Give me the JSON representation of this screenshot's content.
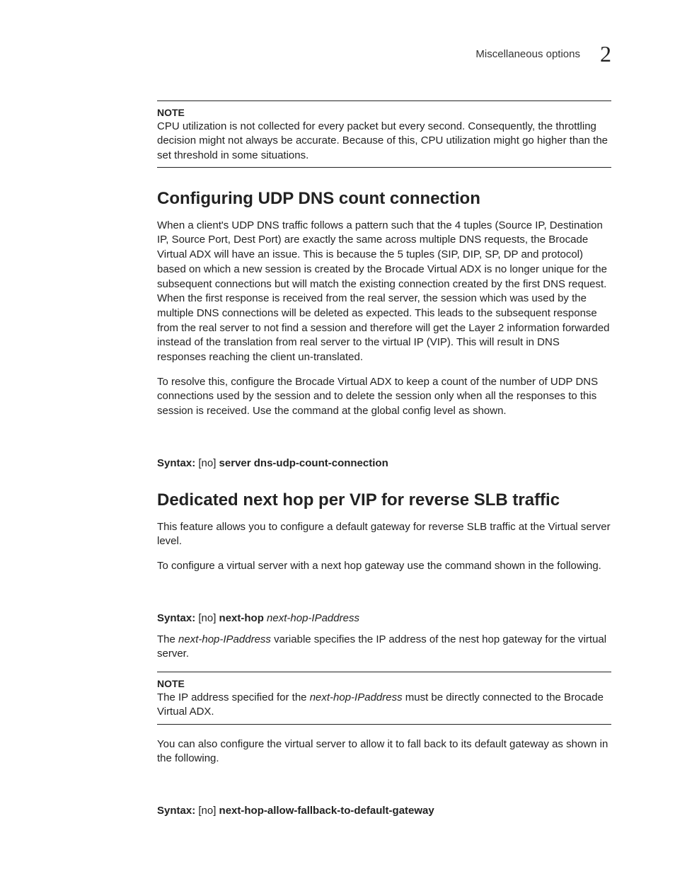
{
  "header": {
    "running_title": "Miscellaneous options",
    "chapter_number": "2"
  },
  "note1": {
    "label": "NOTE",
    "body": "CPU utilization is not collected for every packet but every second. Consequently, the throttling decision might not always be accurate. Because of this, CPU utilization might go higher than the set threshold in some situations."
  },
  "section1": {
    "heading": "Configuring UDP DNS count connection",
    "para1": "When a client's UDP DNS traffic follows a pattern such that the 4 tuples (Source IP, Destination IP, Source Port, Dest Port) are exactly the same across multiple DNS requests, the Brocade Virtual ADX will have an issue. This is because the 5 tuples (SIP, DIP, SP, DP and protocol) based on which a new session is created by the Brocade Virtual ADX is no longer unique for the subsequent connections but will match the existing connection created by the first DNS request. When the first response is received from the real server, the session which was used by the multiple DNS connections will be deleted as expected. This leads to the subsequent response from the real server to not find a session and therefore will get the Layer 2 information forwarded instead of the translation from real server to the virtual IP (VIP). This will result in DNS responses reaching the client un-translated.",
    "para2": "To resolve this, configure the Brocade Virtual ADX to keep a count of the number of UDP DNS connections used by the session and to delete the session only when all the responses to this session is received. Use the command at the global config level as shown.",
    "syntax_label": "Syntax:  ",
    "syntax_no": "[no] ",
    "syntax_cmd": "server dns-udp-count-connection"
  },
  "section2": {
    "heading": "Dedicated next hop per VIP for reverse SLB traffic",
    "para1": "This feature allows you to configure a default gateway for reverse SLB traffic at the Virtual server level.",
    "para2": "To configure a virtual server with a next hop gateway use the command shown in the following.",
    "syntax1_label": "Syntax:  ",
    "syntax1_no": "[no] ",
    "syntax1_cmd": "next-hop ",
    "syntax1_arg": "next-hop-IPaddress",
    "para3_pre": "The ",
    "para3_var": "next-hop-IPaddress",
    "para3_post": " variable specifies the IP address of the nest hop gateway for the virtual server.",
    "note2_label": "NOTE",
    "note2_pre": "The IP address specified for the ",
    "note2_var": "next-hop-IPaddress",
    "note2_post": " must be directly connected to the Brocade Virtual ADX.",
    "para4": "You can also configure the virtual server to allow it to fall back to its default gateway as shown in the following.",
    "syntax2_label": "Syntax:  ",
    "syntax2_no": "[no] ",
    "syntax2_cmd": "next-hop-allow-fallback-to-default-gateway"
  }
}
